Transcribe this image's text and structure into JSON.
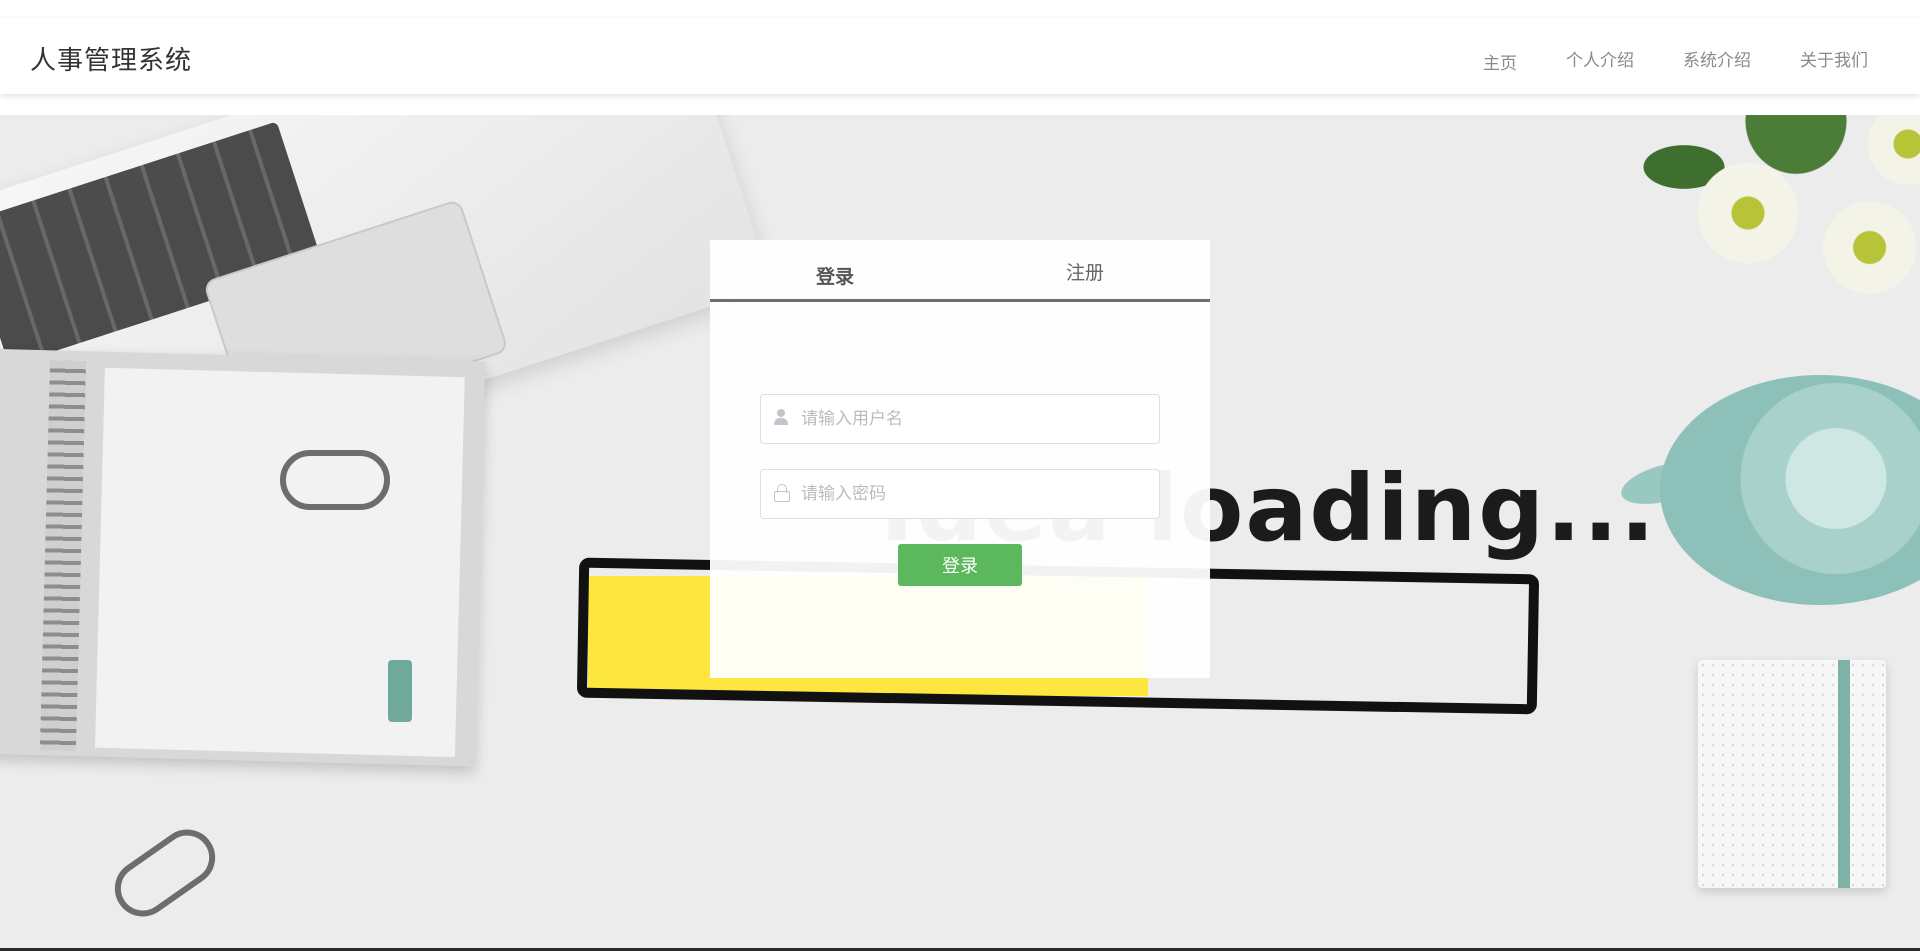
{
  "app": {
    "title": "人事管理系统"
  },
  "nav": {
    "items": [
      {
        "label": "主页"
      },
      {
        "label": "个人介绍"
      },
      {
        "label": "系统介绍"
      },
      {
        "label": "关于我们"
      }
    ]
  },
  "background": {
    "text": "Idea loading..."
  },
  "login": {
    "tabs": [
      {
        "label": "登录",
        "active": true
      },
      {
        "label": "注册",
        "active": false
      }
    ],
    "username": {
      "placeholder": "请输入用户名",
      "value": "",
      "icon": "user-icon"
    },
    "password": {
      "placeholder": "请输入密码",
      "value": "",
      "icon": "lock-icon"
    },
    "submit_label": "登录",
    "submit_color": "#5cb85c"
  }
}
